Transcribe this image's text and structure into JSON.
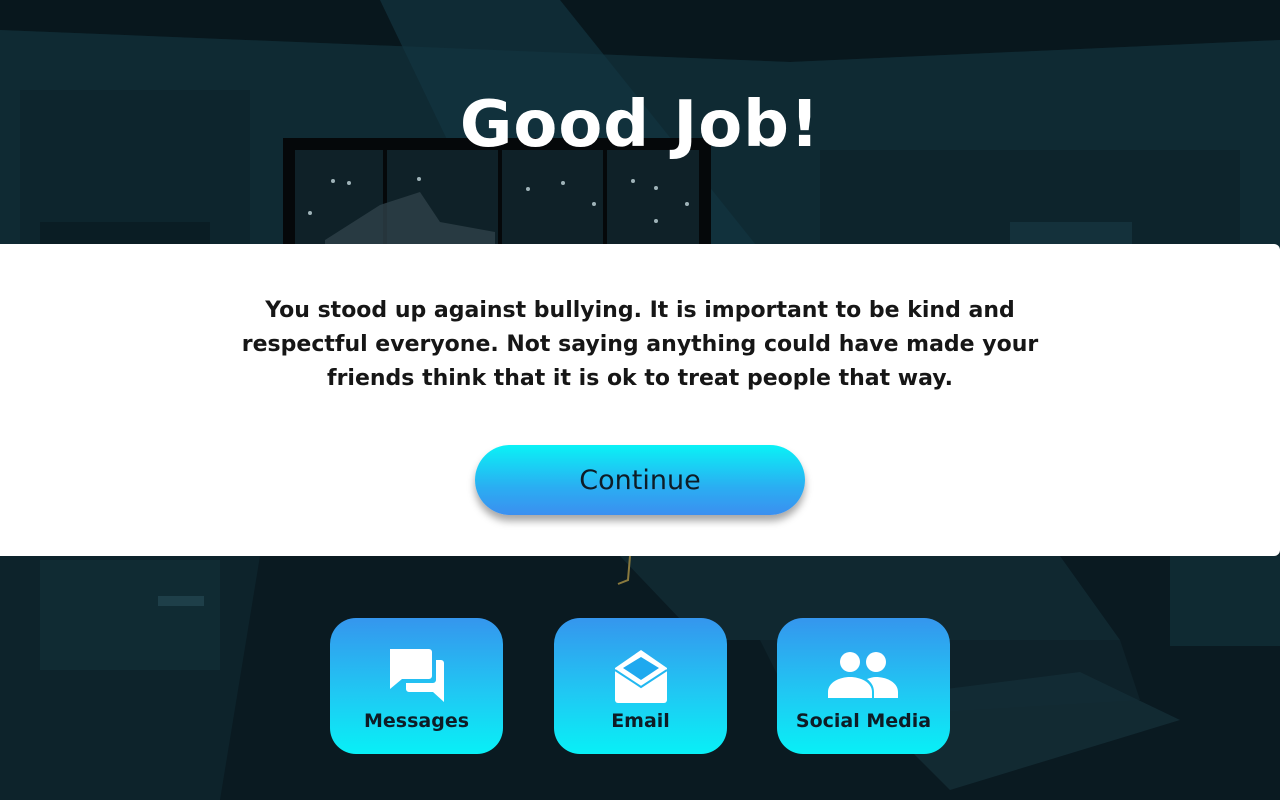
{
  "title": "Good Job!",
  "feedback": {
    "message": "You stood up against bullying. It is important to be kind and respectful everyone. Not saying anything could have made your friends think that it is ok to treat people that way.",
    "continue_label": "Continue"
  },
  "apps": [
    {
      "label": "Messages",
      "icon": "messages-icon"
    },
    {
      "label": "Email",
      "icon": "email-icon"
    },
    {
      "label": "Social Media",
      "icon": "social-media-icon"
    }
  ],
  "colors": {
    "background": "#0b2129",
    "panel": "#ffffff",
    "button_top": "#0af2f6",
    "button_bottom": "#3b8ff0"
  }
}
